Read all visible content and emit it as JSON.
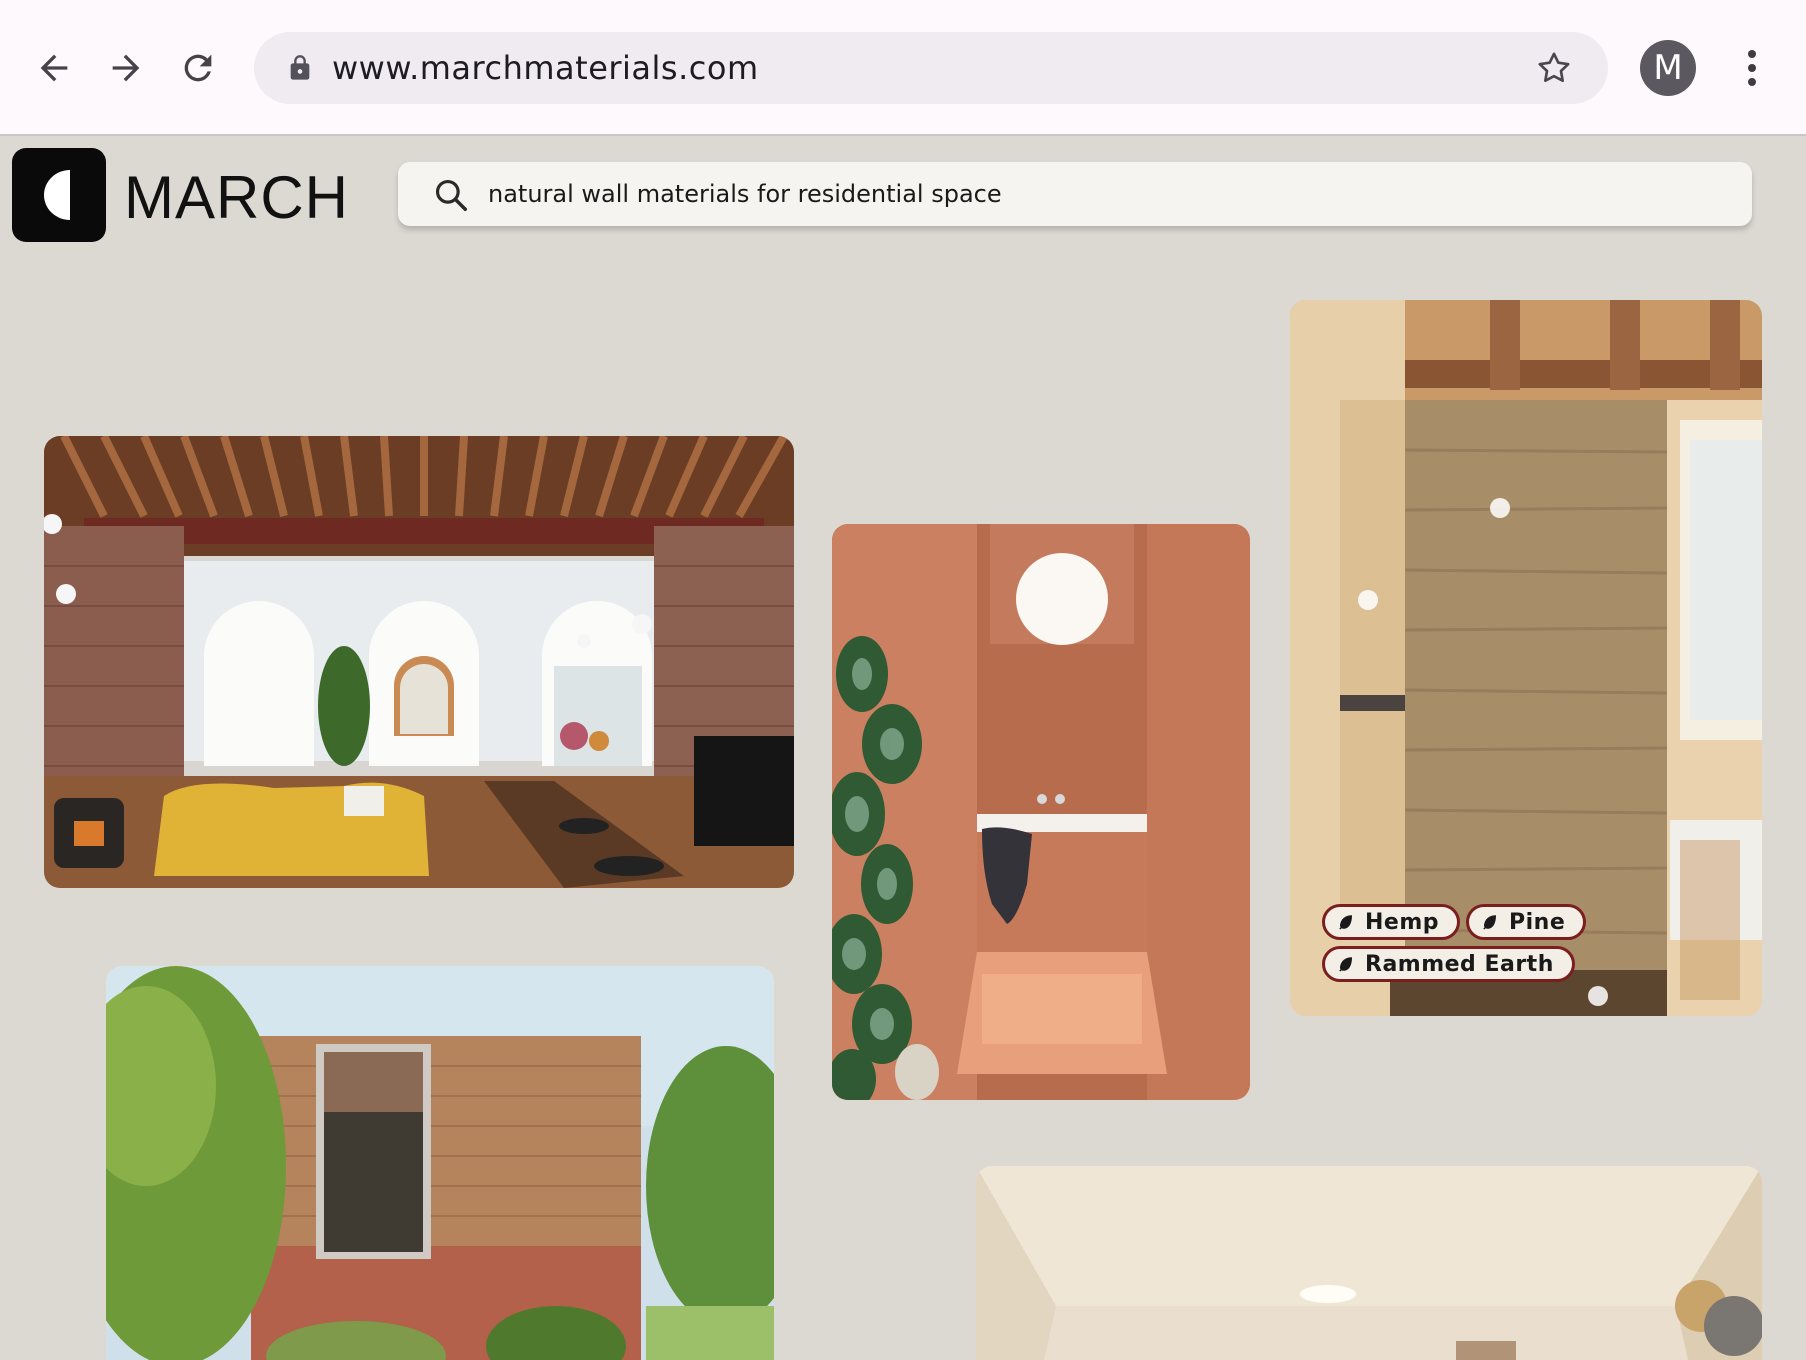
{
  "browser": {
    "url": "www.marchmaterials.com",
    "avatar_letter": "M"
  },
  "site": {
    "logo_text": "MARCH",
    "search_query": "natural wall materials for residential space"
  },
  "cards": {
    "rammed_earth": {
      "tags": [
        "Hemp",
        "Pine",
        "Rammed Earth"
      ]
    }
  },
  "colors": {
    "page_bg": "#dcd9d2",
    "tag_border": "#7a1e1e",
    "chrome_bg": "#fdf9fc"
  }
}
